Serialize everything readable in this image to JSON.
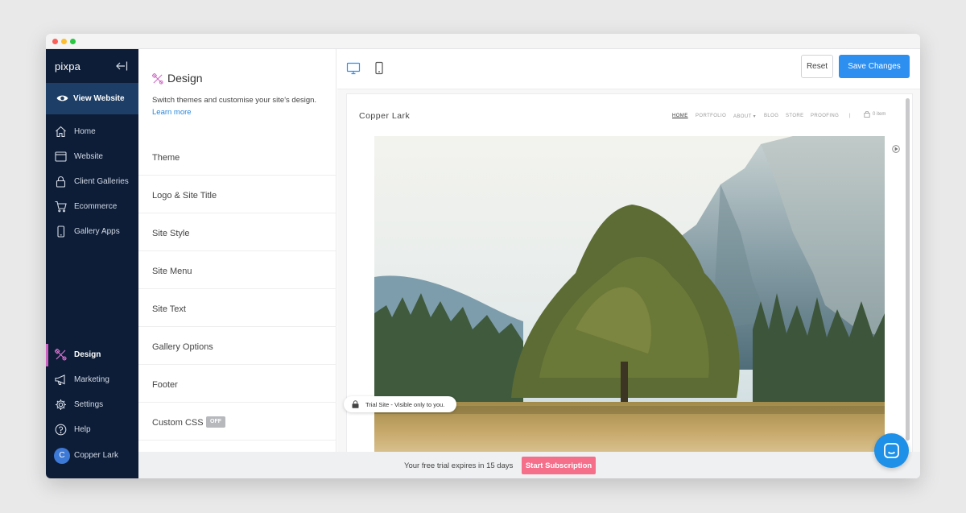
{
  "colors": {
    "sidebar_bg": "#0d1d37",
    "active_accent": "#cf5fc3",
    "primary_button": "#2d8ff0",
    "subscribe_button": "#f56e8a",
    "link": "#2a86d8"
  },
  "sidebar": {
    "logo": "pixpa",
    "view_website": "View Website",
    "items": [
      {
        "label": "Home",
        "icon": "home-icon"
      },
      {
        "label": "Website",
        "icon": "browser-icon"
      },
      {
        "label": "Client Galleries",
        "icon": "lock-icon"
      },
      {
        "label": "Ecommerce",
        "icon": "cart-icon"
      },
      {
        "label": "Gallery Apps",
        "icon": "phone-icon"
      }
    ],
    "bottom_items": [
      {
        "label": "Design",
        "icon": "design-icon",
        "active": true
      },
      {
        "label": "Marketing",
        "icon": "megaphone-icon"
      },
      {
        "label": "Settings",
        "icon": "gear-icon"
      },
      {
        "label": "Help",
        "icon": "help-icon"
      }
    ],
    "user": {
      "initial": "C",
      "name": "Copper Lark"
    }
  },
  "panel": {
    "title": "Design",
    "description": "Switch themes and customise your site's design.",
    "learn_more": "Learn more",
    "options": [
      {
        "label": "Theme"
      },
      {
        "label": "Logo & Site Title"
      },
      {
        "label": "Site Style"
      },
      {
        "label": "Site Menu"
      },
      {
        "label": "Site Text"
      },
      {
        "label": "Gallery Options"
      },
      {
        "label": "Footer"
      },
      {
        "label": "Custom CSS",
        "badge": "OFF"
      }
    ]
  },
  "toolbar": {
    "reset": "Reset",
    "save": "Save Changes",
    "devices": [
      "desktop-icon",
      "mobile-icon"
    ]
  },
  "preview": {
    "site_title": "Copper Lark",
    "nav": [
      "HOME",
      "PORTFOLIO",
      "ABOUT ▾",
      "BLOG",
      "STORE",
      "PROOFING",
      "|"
    ],
    "cart": "0 item",
    "trial_label": "Trial Site - Visible only to you."
  },
  "footer": {
    "message": "Your free trial expires in 15 days",
    "button": "Start Subscription"
  }
}
